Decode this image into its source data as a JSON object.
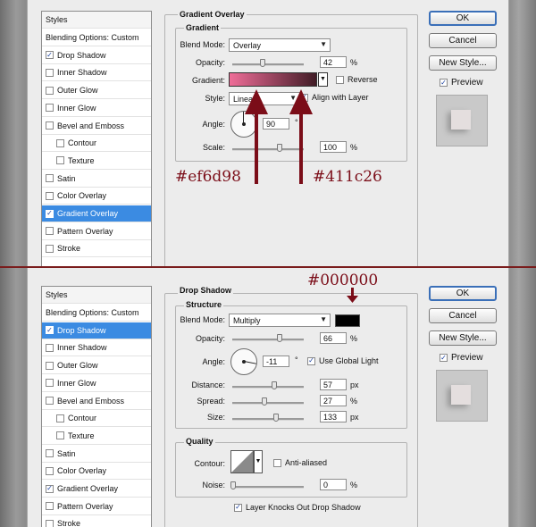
{
  "colors": {
    "gradient_start": "#ef6d98",
    "gradient_end": "#411c26",
    "annotation": "#7b0d18",
    "selection": "#3b8be2",
    "shadow_color": "#000000"
  },
  "top": {
    "styles_list": {
      "header": "Styles",
      "items": [
        {
          "label": "Blending Options: Custom",
          "checkbox": false,
          "checked": false,
          "selected": false,
          "indent": false
        },
        {
          "label": "Drop Shadow",
          "checkbox": true,
          "checked": true,
          "selected": false,
          "indent": false
        },
        {
          "label": "Inner Shadow",
          "checkbox": true,
          "checked": false,
          "selected": false,
          "indent": false
        },
        {
          "label": "Outer Glow",
          "checkbox": true,
          "checked": false,
          "selected": false,
          "indent": false
        },
        {
          "label": "Inner Glow",
          "checkbox": true,
          "checked": false,
          "selected": false,
          "indent": false
        },
        {
          "label": "Bevel and Emboss",
          "checkbox": true,
          "checked": false,
          "selected": false,
          "indent": false
        },
        {
          "label": "Contour",
          "checkbox": true,
          "checked": false,
          "selected": false,
          "indent": true
        },
        {
          "label": "Texture",
          "checkbox": true,
          "checked": false,
          "selected": false,
          "indent": true
        },
        {
          "label": "Satin",
          "checkbox": true,
          "checked": false,
          "selected": false,
          "indent": false
        },
        {
          "label": "Color Overlay",
          "checkbox": true,
          "checked": false,
          "selected": false,
          "indent": false
        },
        {
          "label": "Gradient Overlay",
          "checkbox": true,
          "checked": true,
          "selected": true,
          "indent": false
        },
        {
          "label": "Pattern Overlay",
          "checkbox": true,
          "checked": false,
          "selected": false,
          "indent": false
        },
        {
          "label": "Stroke",
          "checkbox": true,
          "checked": false,
          "selected": false,
          "indent": false
        }
      ]
    },
    "section_title": "Gradient Overlay",
    "group_title": "Gradient",
    "blend_mode_label": "Blend Mode:",
    "blend_mode_value": "Overlay",
    "opacity_label": "Opacity:",
    "opacity_value": "42",
    "opacity_percent": 42,
    "percent": "%",
    "gradient_label": "Gradient:",
    "reverse_label": "Reverse",
    "style_label": "Style:",
    "style_value": "Linear",
    "align_label": "Align with Layer",
    "angle_label": "Angle:",
    "angle_value": "90",
    "degree": "°",
    "scale_label": "Scale:",
    "scale_value": "100",
    "scale_percent": 100,
    "annot_left": "#ef6d98",
    "annot_right": "#411c26"
  },
  "bottom": {
    "styles_list": {
      "header": "Styles",
      "items": [
        {
          "label": "Blending Options: Custom",
          "checkbox": false,
          "checked": false,
          "selected": false,
          "indent": false
        },
        {
          "label": "Drop Shadow",
          "checkbox": true,
          "checked": true,
          "selected": true,
          "indent": false
        },
        {
          "label": "Inner Shadow",
          "checkbox": true,
          "checked": false,
          "selected": false,
          "indent": false
        },
        {
          "label": "Outer Glow",
          "checkbox": true,
          "checked": false,
          "selected": false,
          "indent": false
        },
        {
          "label": "Inner Glow",
          "checkbox": true,
          "checked": false,
          "selected": false,
          "indent": false
        },
        {
          "label": "Bevel and Emboss",
          "checkbox": true,
          "checked": false,
          "selected": false,
          "indent": false
        },
        {
          "label": "Contour",
          "checkbox": true,
          "checked": false,
          "selected": false,
          "indent": true
        },
        {
          "label": "Texture",
          "checkbox": true,
          "checked": false,
          "selected": false,
          "indent": true
        },
        {
          "label": "Satin",
          "checkbox": true,
          "checked": false,
          "selected": false,
          "indent": false
        },
        {
          "label": "Color Overlay",
          "checkbox": true,
          "checked": false,
          "selected": false,
          "indent": false
        },
        {
          "label": "Gradient Overlay",
          "checkbox": true,
          "checked": true,
          "selected": false,
          "indent": false
        },
        {
          "label": "Pattern Overlay",
          "checkbox": true,
          "checked": false,
          "selected": false,
          "indent": false
        },
        {
          "label": "Stroke",
          "checkbox": true,
          "checked": false,
          "selected": false,
          "indent": false
        }
      ]
    },
    "section_title": "Drop Shadow",
    "group_title": "Structure",
    "blend_mode_label": "Blend Mode:",
    "blend_mode_value": "Multiply",
    "opacity_label": "Opacity:",
    "opacity_value": "66",
    "opacity_percent": 66,
    "percent": "%",
    "angle_label": "Angle:",
    "angle_value": "-11",
    "degree": "°",
    "global_light_label": "Use Global Light",
    "distance_label": "Distance:",
    "distance_value": "57",
    "spread_label": "Spread:",
    "spread_value": "27",
    "spread_percent": 27,
    "size_label": "Size:",
    "size_value": "133",
    "px": "px",
    "quality_title": "Quality",
    "contour_label": "Contour:",
    "anti_alias_label": "Anti-aliased",
    "noise_label": "Noise:",
    "noise_value": "0",
    "knockout_label": "Layer Knocks Out Drop Shadow",
    "annot_color": "#000000"
  },
  "buttons": {
    "ok": "OK",
    "cancel": "Cancel",
    "new_style": "New Style...",
    "preview": "Preview"
  }
}
